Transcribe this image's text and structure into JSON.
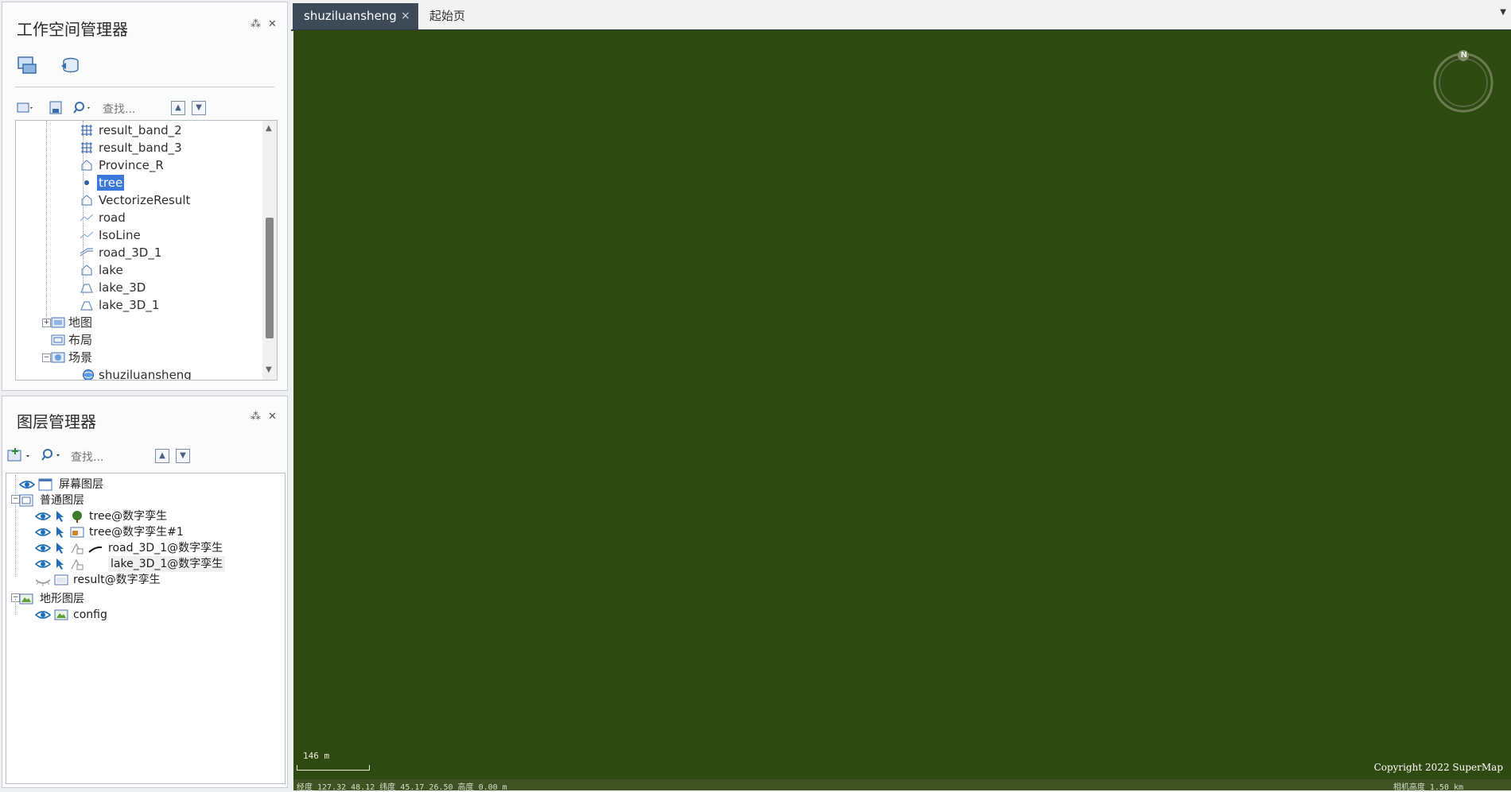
{
  "workspace": {
    "title": "工作空间管理器",
    "pin_icon": "pin-icon",
    "close_icon": "close-icon",
    "search_placeholder": "查找...",
    "tree_items": [
      {
        "label": "result_band_2",
        "icon": "grid-dataset-icon"
      },
      {
        "label": "result_band_3",
        "icon": "grid-dataset-icon"
      },
      {
        "label": "Province_R",
        "icon": "region-dataset-icon"
      },
      {
        "label": "tree",
        "icon": "point-dataset-icon",
        "selected": true
      },
      {
        "label": "VectorizeResult",
        "icon": "region-dataset-icon"
      },
      {
        "label": "road",
        "icon": "line-dataset-icon"
      },
      {
        "label": "IsoLine",
        "icon": "line-dataset-icon"
      },
      {
        "label": "road_3D_1",
        "icon": "line3d-dataset-icon"
      },
      {
        "label": "lake",
        "icon": "region-dataset-icon"
      },
      {
        "label": "lake_3D",
        "icon": "region3d-dataset-icon"
      },
      {
        "label": "lake_3D_1",
        "icon": "region3d-dataset-icon"
      }
    ],
    "groups": [
      {
        "label": "地图",
        "expander": "+"
      },
      {
        "label": "布局",
        "expander": ""
      },
      {
        "label": "场景",
        "expander": "−"
      }
    ],
    "scene_item": "shuziluansheng"
  },
  "layers": {
    "title": "图层管理器",
    "search_placeholder": "查找...",
    "rows": [
      {
        "label": "屏幕图层",
        "indent": 0
      },
      {
        "label": "普通图层",
        "indent": 0
      },
      {
        "label": "tree@数字孪生",
        "indent": 1
      },
      {
        "label": "tree@数字孪生#1",
        "indent": 1
      },
      {
        "label": "road_3D_1@数字孪生",
        "indent": 1
      },
      {
        "label": "lake_3D_1@数字孪生",
        "indent": 1
      },
      {
        "label": "result@数字孪生",
        "indent": 1
      },
      {
        "label": "地形图层",
        "indent": 0
      },
      {
        "label": "config",
        "indent": 1
      }
    ]
  },
  "tabs": [
    {
      "label": "shuziluansheng",
      "active": true,
      "close": "×"
    },
    {
      "label": "起始页",
      "active": false
    }
  ],
  "scene": {
    "compass_label": "N",
    "scale_text": "146 m",
    "copyright": "Copyright 2022 SuperMap",
    "status_left": "经度 127.32   48.12   纬度 45.17   26.50  高度 0.00 m",
    "status_right": "相机高度 1.50 km"
  },
  "colors": {
    "scene_bg": "#2f4a10",
    "accent": "#3b78d8"
  }
}
